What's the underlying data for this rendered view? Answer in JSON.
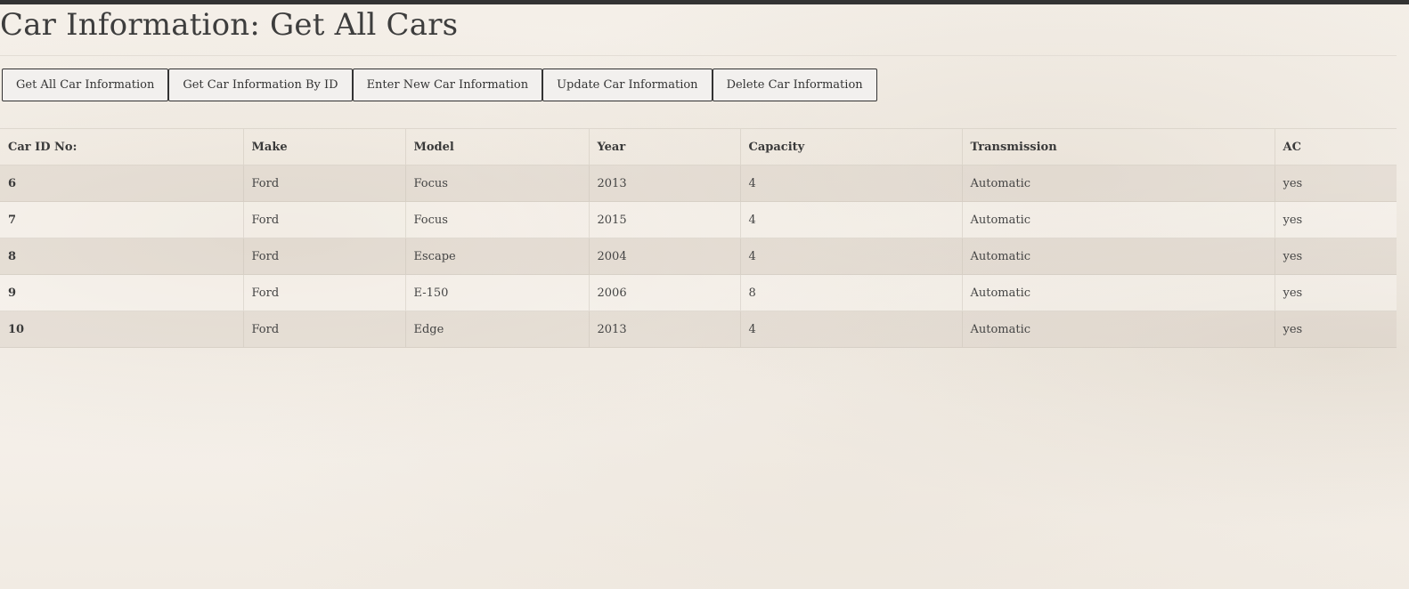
{
  "page": {
    "title": "Car Information: Get All Cars"
  },
  "buttons": [
    {
      "label": "Get All Car Information"
    },
    {
      "label": "Get Car Information By ID"
    },
    {
      "label": "Enter New Car Information"
    },
    {
      "label": "Update Car Information"
    },
    {
      "label": "Delete Car Information"
    }
  ],
  "table": {
    "columns": [
      "Car ID No:",
      "Make",
      "Model",
      "Year",
      "Capacity",
      "Transmission",
      "AC"
    ],
    "rows": [
      [
        "6",
        "Ford",
        "Focus",
        "2013",
        "4",
        "Automatic",
        "yes"
      ],
      [
        "7",
        "Ford",
        "Focus",
        "2015",
        "4",
        "Automatic",
        "yes"
      ],
      [
        "8",
        "Ford",
        "Escape",
        "2004",
        "4",
        "Automatic",
        "yes"
      ],
      [
        "9",
        "Ford",
        "E-150",
        "2006",
        "8",
        "Automatic",
        "yes"
      ],
      [
        "10",
        "Ford",
        "Edge",
        "2013",
        "4",
        "Automatic",
        "yes"
      ]
    ]
  },
  "colors": {
    "topbar": "#333333",
    "text": "#444444",
    "button_border": "#333333"
  }
}
